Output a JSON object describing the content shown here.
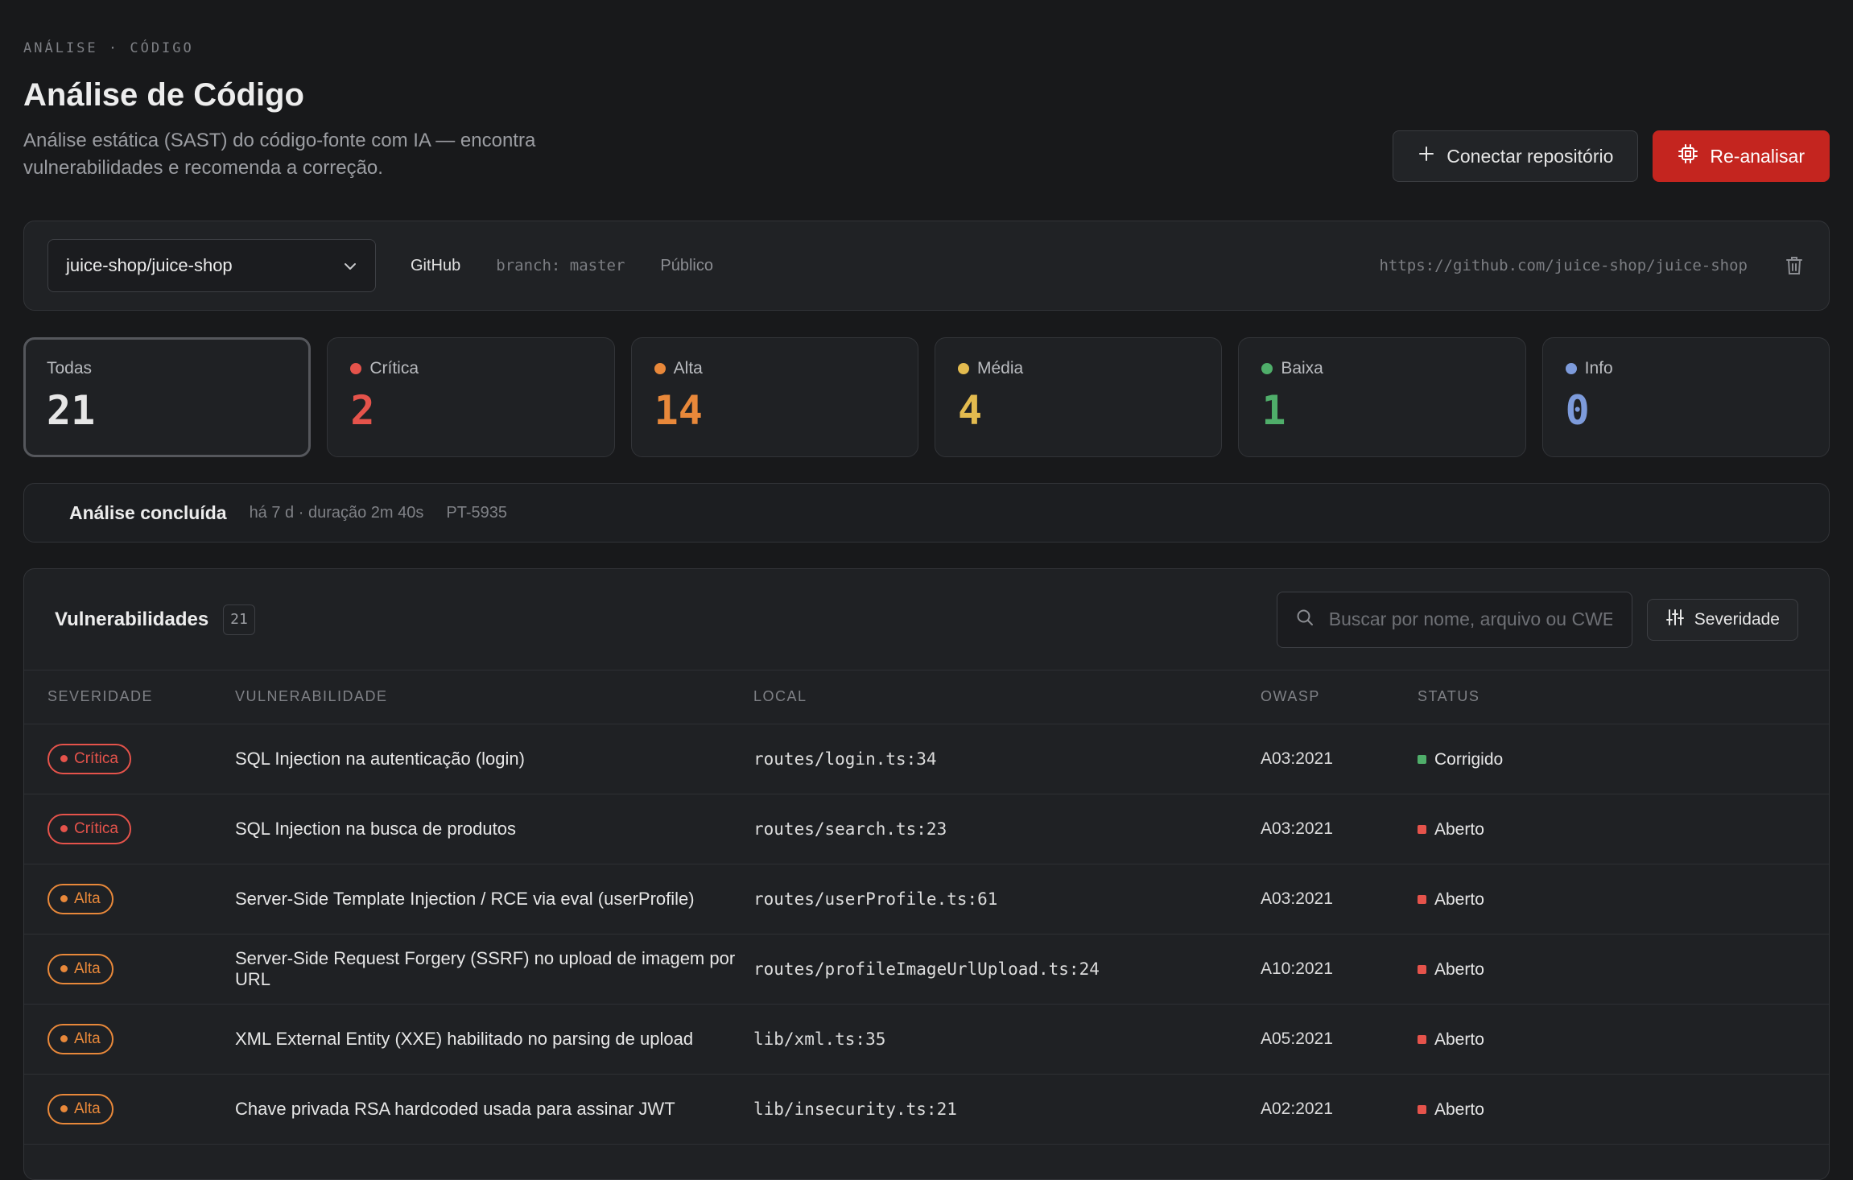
{
  "header": {
    "breadcrumb": "ANÁLISE · CÓDIGO",
    "title": "Análise de Código",
    "subtitle": "Análise estática (SAST) do código-fonte com IA — encontra vulnerabilidades e recomenda a correção.",
    "connect_label": "Conectar repositório",
    "reanalyze_label": "Re-analisar"
  },
  "repo": {
    "selected": "juice-shop/juice-shop",
    "provider": "GitHub",
    "branch": "branch: master",
    "visibility": "Público",
    "url": "https://github.com/juice-shop/juice-shop"
  },
  "stats": [
    {
      "label": "Todas",
      "value": "21",
      "color": "#e6e6e6",
      "dot": ""
    },
    {
      "label": "Crítica",
      "value": "2",
      "color": "#e5534b",
      "dot": "#e5534b"
    },
    {
      "label": "Alta",
      "value": "14",
      "color": "#e8883a",
      "dot": "#e8883a"
    },
    {
      "label": "Média",
      "value": "4",
      "color": "#e3bb4f",
      "dot": "#e3bb4f"
    },
    {
      "label": "Baixa",
      "value": "1",
      "color": "#4fae6a",
      "dot": "#4fae6a"
    },
    {
      "label": "Info",
      "value": "0",
      "color": "#7d9bdb",
      "dot": "#7d9bdb"
    }
  ],
  "scan": {
    "status": "Análise concluída",
    "meta": "há 7 d · duração 2m 40s",
    "id": "PT-5935"
  },
  "vulns": {
    "title": "Vulnerabilidades",
    "count": "21",
    "search_placeholder": "Buscar por nome, arquivo ou CWE",
    "filter_label": "Severidade",
    "columns": [
      "SEVERIDADE",
      "VULNERABILIDADE",
      "LOCAL",
      "OWASP",
      "STATUS"
    ],
    "rows": [
      {
        "severity": "Crítica",
        "sev_color": "#e5534b",
        "title": "SQL Injection na autenticação (login)",
        "location": "routes/login.ts:34",
        "owasp": "A03:2021",
        "status": "Corrigido",
        "status_color": "#4fae6a"
      },
      {
        "severity": "Crítica",
        "sev_color": "#e5534b",
        "title": "SQL Injection na busca de produtos",
        "location": "routes/search.ts:23",
        "owasp": "A03:2021",
        "status": "Aberto",
        "status_color": "#e5534b"
      },
      {
        "severity": "Alta",
        "sev_color": "#e8883a",
        "title": "Server-Side Template Injection / RCE via eval (userProfile)",
        "location": "routes/userProfile.ts:61",
        "owasp": "A03:2021",
        "status": "Aberto",
        "status_color": "#e5534b"
      },
      {
        "severity": "Alta",
        "sev_color": "#e8883a",
        "title": "Server-Side Request Forgery (SSRF) no upload de imagem por URL",
        "location": "routes/profileImageUrlUpload.ts:24",
        "owasp": "A10:2021",
        "status": "Aberto",
        "status_color": "#e5534b"
      },
      {
        "severity": "Alta",
        "sev_color": "#e8883a",
        "title": "XML External Entity (XXE) habilitado no parsing de upload",
        "location": "lib/xml.ts:35",
        "owasp": "A05:2021",
        "status": "Aberto",
        "status_color": "#e5534b"
      },
      {
        "severity": "Alta",
        "sev_color": "#e8883a",
        "title": "Chave privada RSA hardcoded usada para assinar JWT",
        "location": "lib/insecurity.ts:21",
        "owasp": "A02:2021",
        "status": "Aberto",
        "status_color": "#e5534b"
      }
    ]
  },
  "icons": {
    "plus": "plus-icon",
    "reanalyze": "chip-icon",
    "chevron": "chevron-down-icon",
    "trash": "trash-icon",
    "search": "search-icon",
    "filter": "sliders-icon"
  }
}
